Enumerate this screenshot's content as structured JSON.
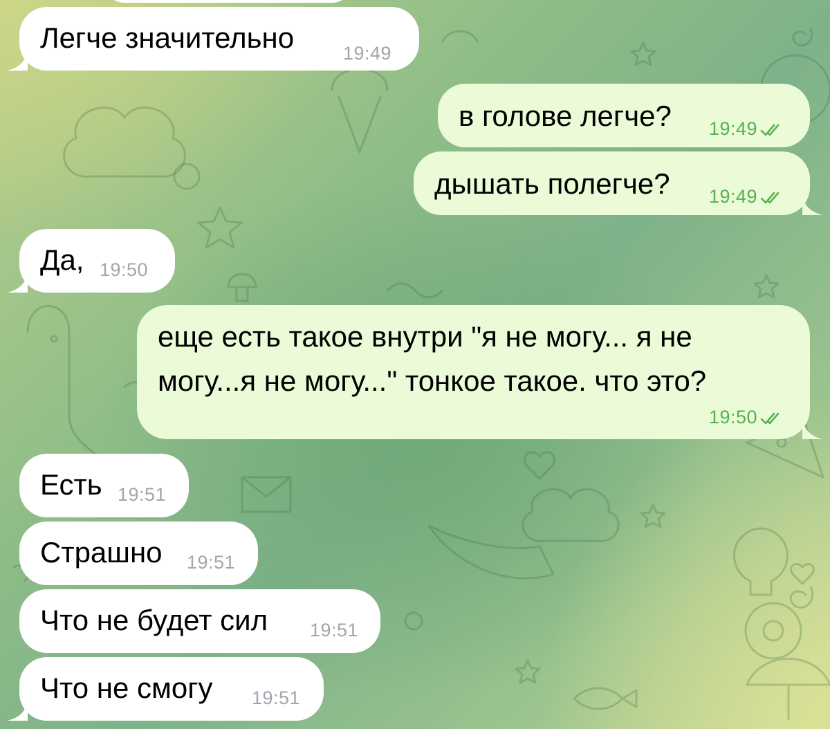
{
  "messages": [
    {
      "side": "in",
      "text": "Легче значительно",
      "time": "19:49"
    },
    {
      "side": "out",
      "text": "в голове легче?",
      "time": "19:49",
      "read": true
    },
    {
      "side": "out",
      "text": "дышать полегче?",
      "time": "19:49",
      "read": true
    },
    {
      "side": "in",
      "text": "Да,",
      "time": "19:50"
    },
    {
      "side": "out",
      "text_line1": "еще есть такое внутри \"я не могу... я не",
      "text_line2": "могу...я не могу...\" тонкое такое. что это?",
      "time": "19:50",
      "read": true
    },
    {
      "side": "in",
      "text": "Есть",
      "time": "19:51"
    },
    {
      "side": "in",
      "text": "Страшно",
      "time": "19:51"
    },
    {
      "side": "in",
      "text": "Что не будет сил",
      "time": "19:51"
    },
    {
      "side": "in",
      "text": "Что не смогу",
      "time": "19:51"
    }
  ],
  "colors": {
    "incoming_bubble": "#ffffff",
    "outgoing_bubble": "#ebfbd8",
    "incoming_time": "#a0a6ad",
    "outgoing_time": "#55b04f"
  },
  "icons": {
    "read_receipt": "double-check-icon",
    "wallpaper": "doodle-pattern"
  }
}
